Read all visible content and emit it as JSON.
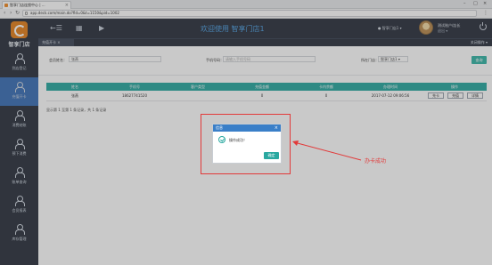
{
  "browser": {
    "tab_title": "智享门店连锁中心 | ...",
    "tab_close": "×",
    "url": "app.deck.com/main.do?fId=0&t=1150&pid=1002",
    "win_min": "–",
    "win_max": "□",
    "win_close": "×",
    "nav_back": "‹",
    "nav_forward": "›",
    "nav_reload": "↻",
    "menu": "⋮"
  },
  "sidebar": {
    "logo_text": "智享门店",
    "items": [
      {
        "label": "到店登记",
        "icon": "person-icon"
      },
      {
        "label": "充值开卡",
        "icon": "person-icon",
        "active": true
      },
      {
        "label": "消费结账",
        "icon": "person-icon"
      },
      {
        "label": "预下消费",
        "icon": "person-icon"
      },
      {
        "label": "账单查询",
        "icon": "person-icon"
      },
      {
        "label": "会员报表",
        "icon": "person-icon"
      },
      {
        "label": "库存管理",
        "icon": "person-icon"
      }
    ]
  },
  "topbar": {
    "menu_icon": "←☰",
    "grid_icon": "▦",
    "video_icon": "▶",
    "welcome": "欢迎使用  智享门店1",
    "store": "● 智享门店1 ▾",
    "user_name": "测试账户/店长",
    "user_role": "退出 ▾"
  },
  "subbar": {
    "tab": "充值开卡 ×",
    "close_ops": "关闭操作 ▾"
  },
  "filters": {
    "member_name_label": "会员姓名：",
    "member_name_value": "张燕",
    "phone_label": "手机号码：",
    "phone_placeholder": "请输入手机号码",
    "store_label": "所在门店：",
    "store_value": "智享门店1  ▾",
    "search_btn": "查询"
  },
  "table": {
    "headers": [
      "姓名",
      "手机号",
      "客户类型",
      "充值金额",
      "卡内余额",
      "办理时间",
      "操作"
    ],
    "rows": [
      {
        "name": "张燕",
        "phone": "18627741520",
        "type": "",
        "recharge": "0",
        "balance": "0",
        "time": "2017-07-12 09:06:56",
        "btn1": "充卡",
        "btn2": "充值",
        "btn3": "详情"
      }
    ]
  },
  "pager": "显示第 1 至第 1 条记录，共 1 条记录",
  "dialog": {
    "title": "信息",
    "close": "×",
    "message": "操作成功！",
    "ok": "确定"
  },
  "annotation": {
    "note": "办卡成功",
    "color": "#e23a3a"
  }
}
